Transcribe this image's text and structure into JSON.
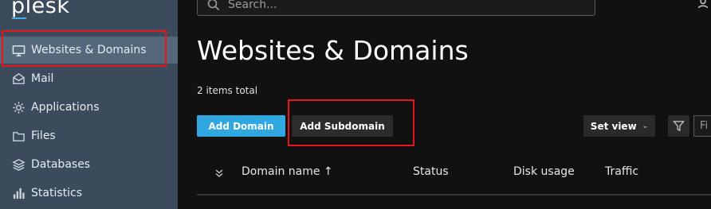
{
  "app": {
    "logo": "plesk"
  },
  "sidebar": {
    "items": [
      {
        "label": "Websites & Domains",
        "icon": "monitor-icon",
        "active": true
      },
      {
        "label": "Mail",
        "icon": "envelope-icon",
        "active": false
      },
      {
        "label": "Applications",
        "icon": "gear-icon",
        "active": false
      },
      {
        "label": "Files",
        "icon": "folder-icon",
        "active": false
      },
      {
        "label": "Databases",
        "icon": "database-icon",
        "active": false
      },
      {
        "label": "Statistics",
        "icon": "bar-chart-icon",
        "active": false
      }
    ]
  },
  "header": {
    "search_placeholder": "Search...",
    "user_icon": "user-icon"
  },
  "main": {
    "title": "Websites & Domains",
    "items_total": "2 items total",
    "add_domain_label": "Add Domain",
    "add_subdomain_label": "Add Subdomain",
    "set_view_label": "Set view",
    "filter_placeholder": "Fi",
    "table": {
      "columns": [
        "Domain name ↑",
        "Status",
        "Disk usage",
        "Traffic"
      ]
    }
  },
  "colors": {
    "sidebar_bg": "#3c4b5b",
    "sidebar_active": "#55677a",
    "primary": "#2fa8e2",
    "highlight": "#e8151b",
    "main_bg": "#111111"
  }
}
